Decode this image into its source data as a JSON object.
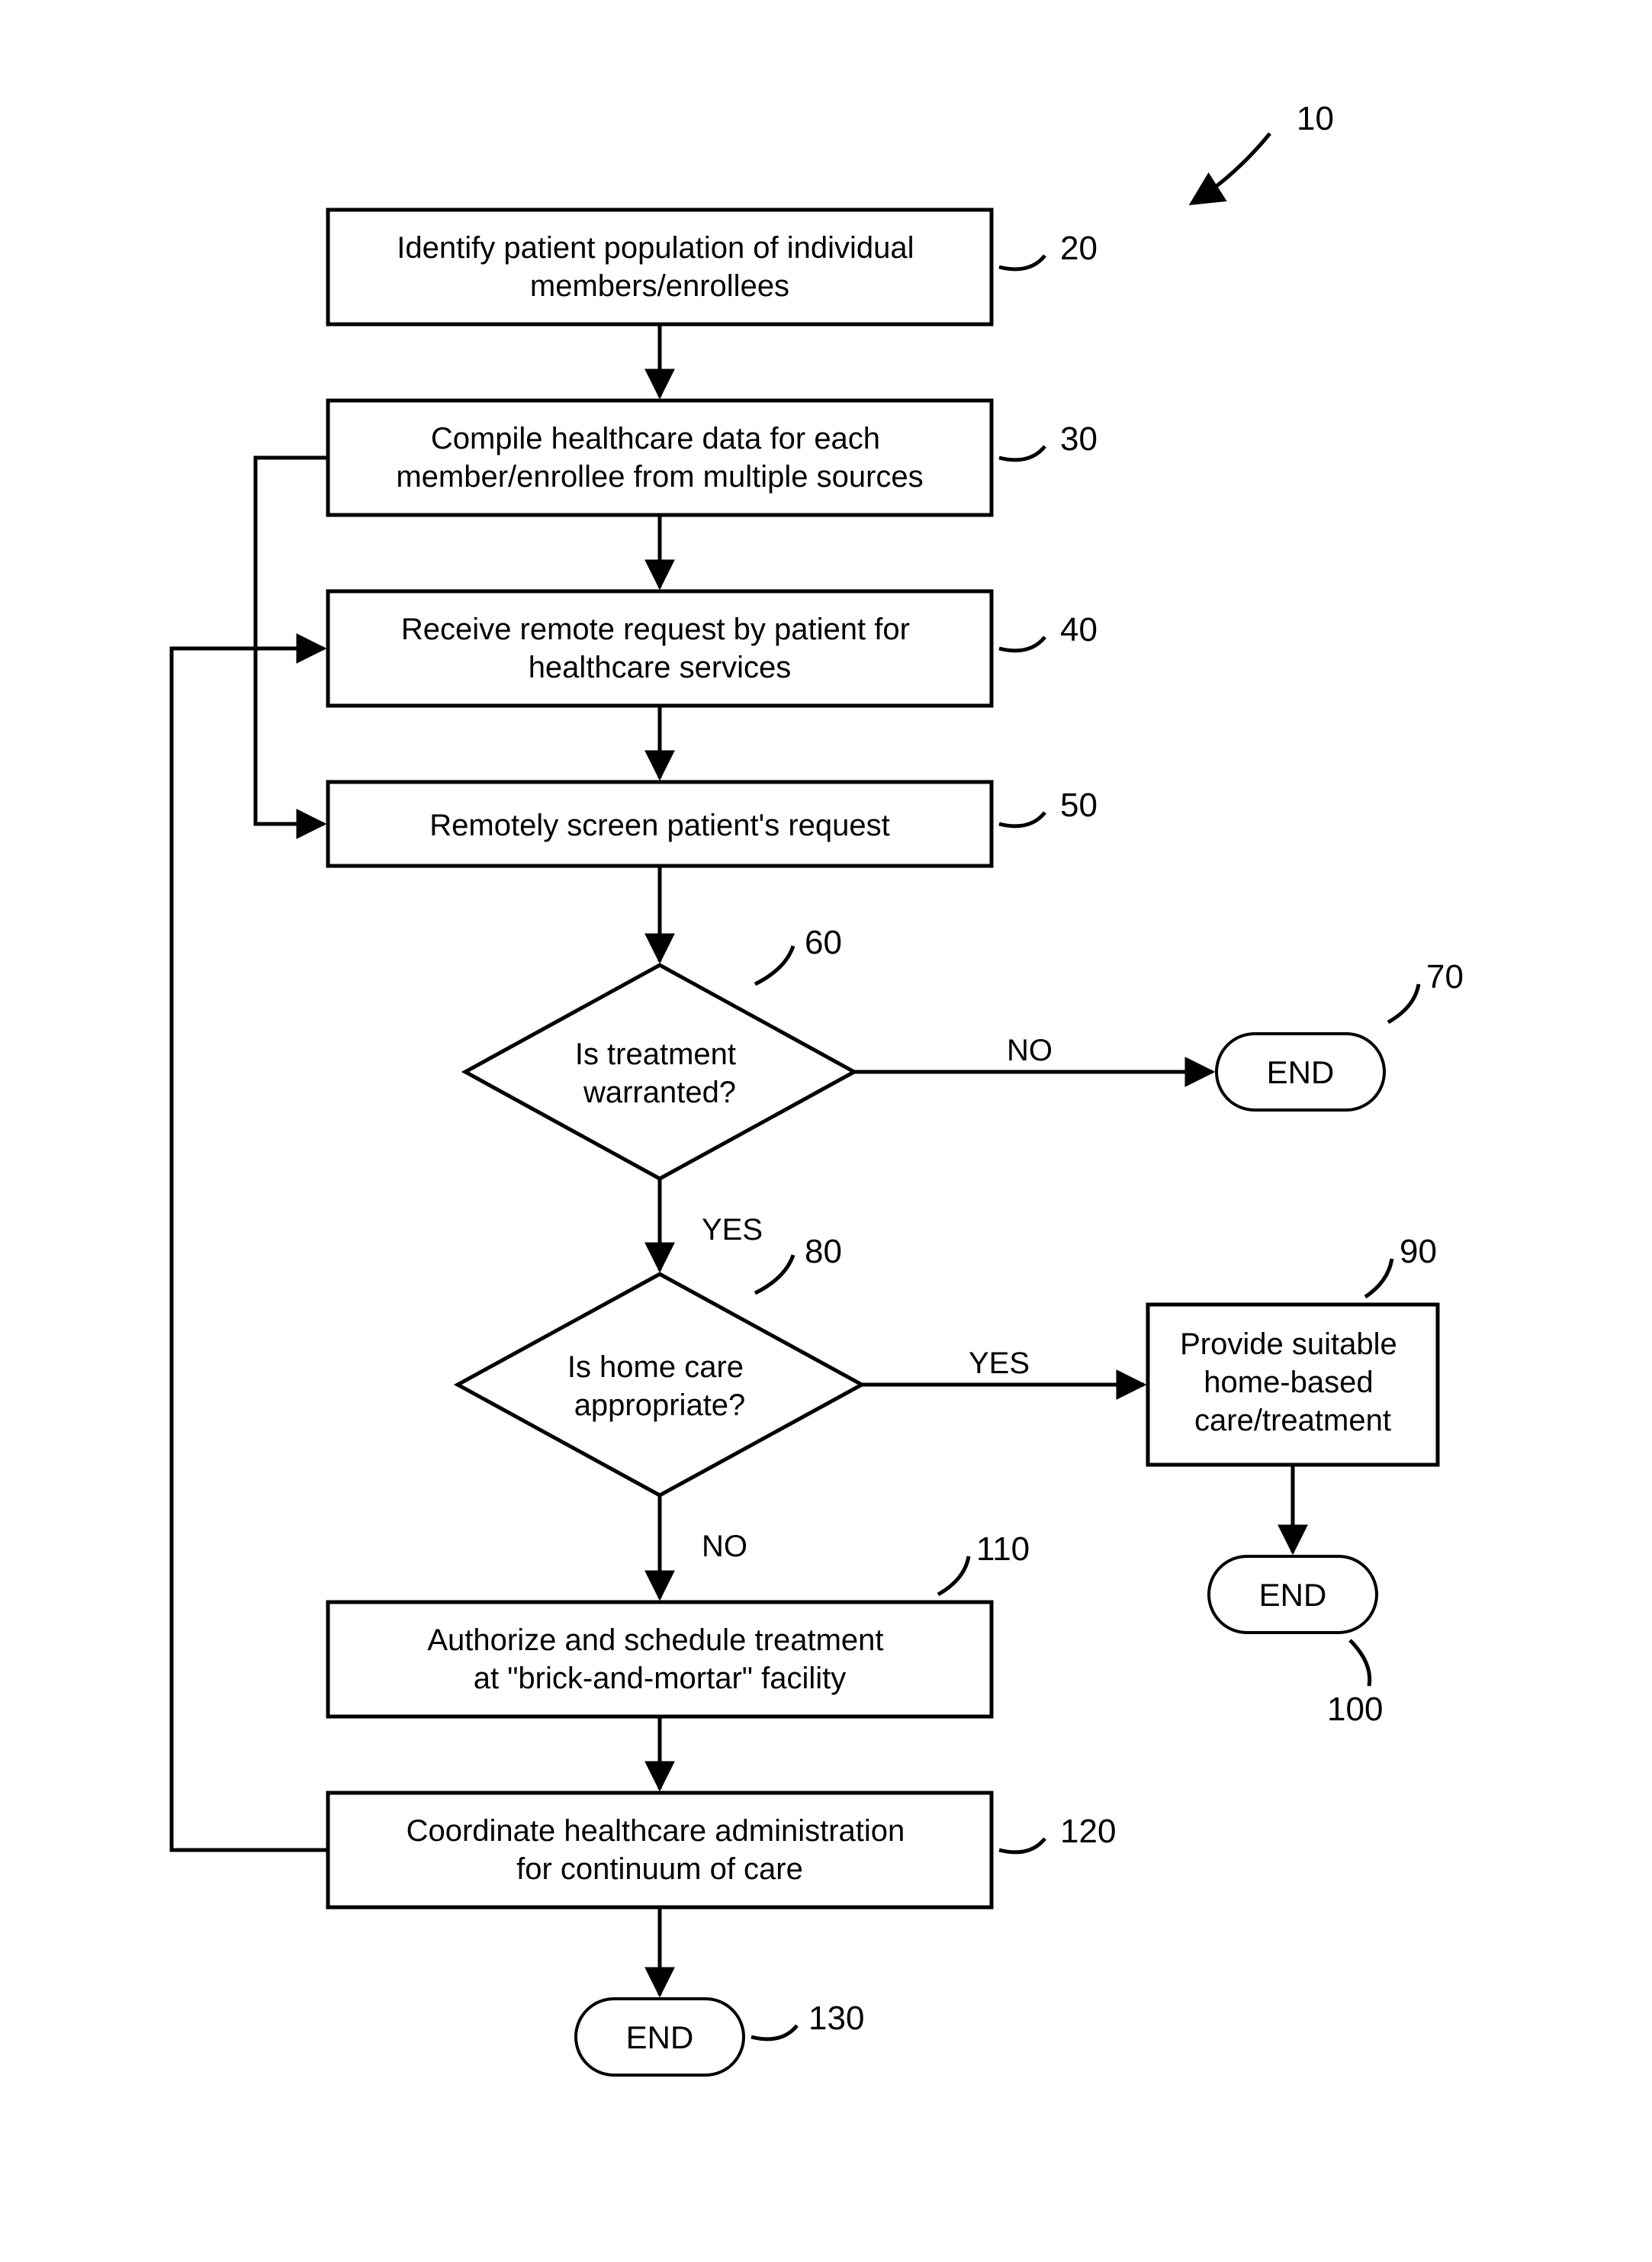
{
  "diagram": {
    "refArrowLabel": "10",
    "nodes": {
      "b20": {
        "ref": "20",
        "lines": [
          "Identify patient population of individual",
          "members/enrollees"
        ]
      },
      "b30": {
        "ref": "30",
        "lines": [
          "Compile healthcare data for each",
          "member/enrollee from multiple sources"
        ]
      },
      "b40": {
        "ref": "40",
        "lines": [
          "Receive remote request by patient for",
          "healthcare services"
        ]
      },
      "b50": {
        "ref": "50",
        "lines": [
          "Remotely screen patient's request"
        ]
      },
      "d60": {
        "ref": "60",
        "lines": [
          "Is treatment",
          "warranted?"
        ]
      },
      "t70": {
        "ref": "70",
        "text": "END"
      },
      "d80": {
        "ref": "80",
        "lines": [
          "Is home care",
          "appropriate?"
        ]
      },
      "b90": {
        "ref": "90",
        "lines": [
          "Provide suitable",
          "home-based",
          "care/treatment"
        ]
      },
      "t100": {
        "ref": "100",
        "text": "END"
      },
      "b110": {
        "ref": "110",
        "lines": [
          "Authorize and schedule treatment",
          "at \"brick-and-mortar\" facility"
        ]
      },
      "b120": {
        "ref": "120",
        "lines": [
          "Coordinate healthcare administration",
          "for continuum of care"
        ]
      },
      "t130": {
        "ref": "130",
        "text": "END"
      }
    },
    "edgeLabels": {
      "d60_no": "NO",
      "d60_yes": "YES",
      "d80_yes": "YES",
      "d80_no": "NO"
    }
  }
}
